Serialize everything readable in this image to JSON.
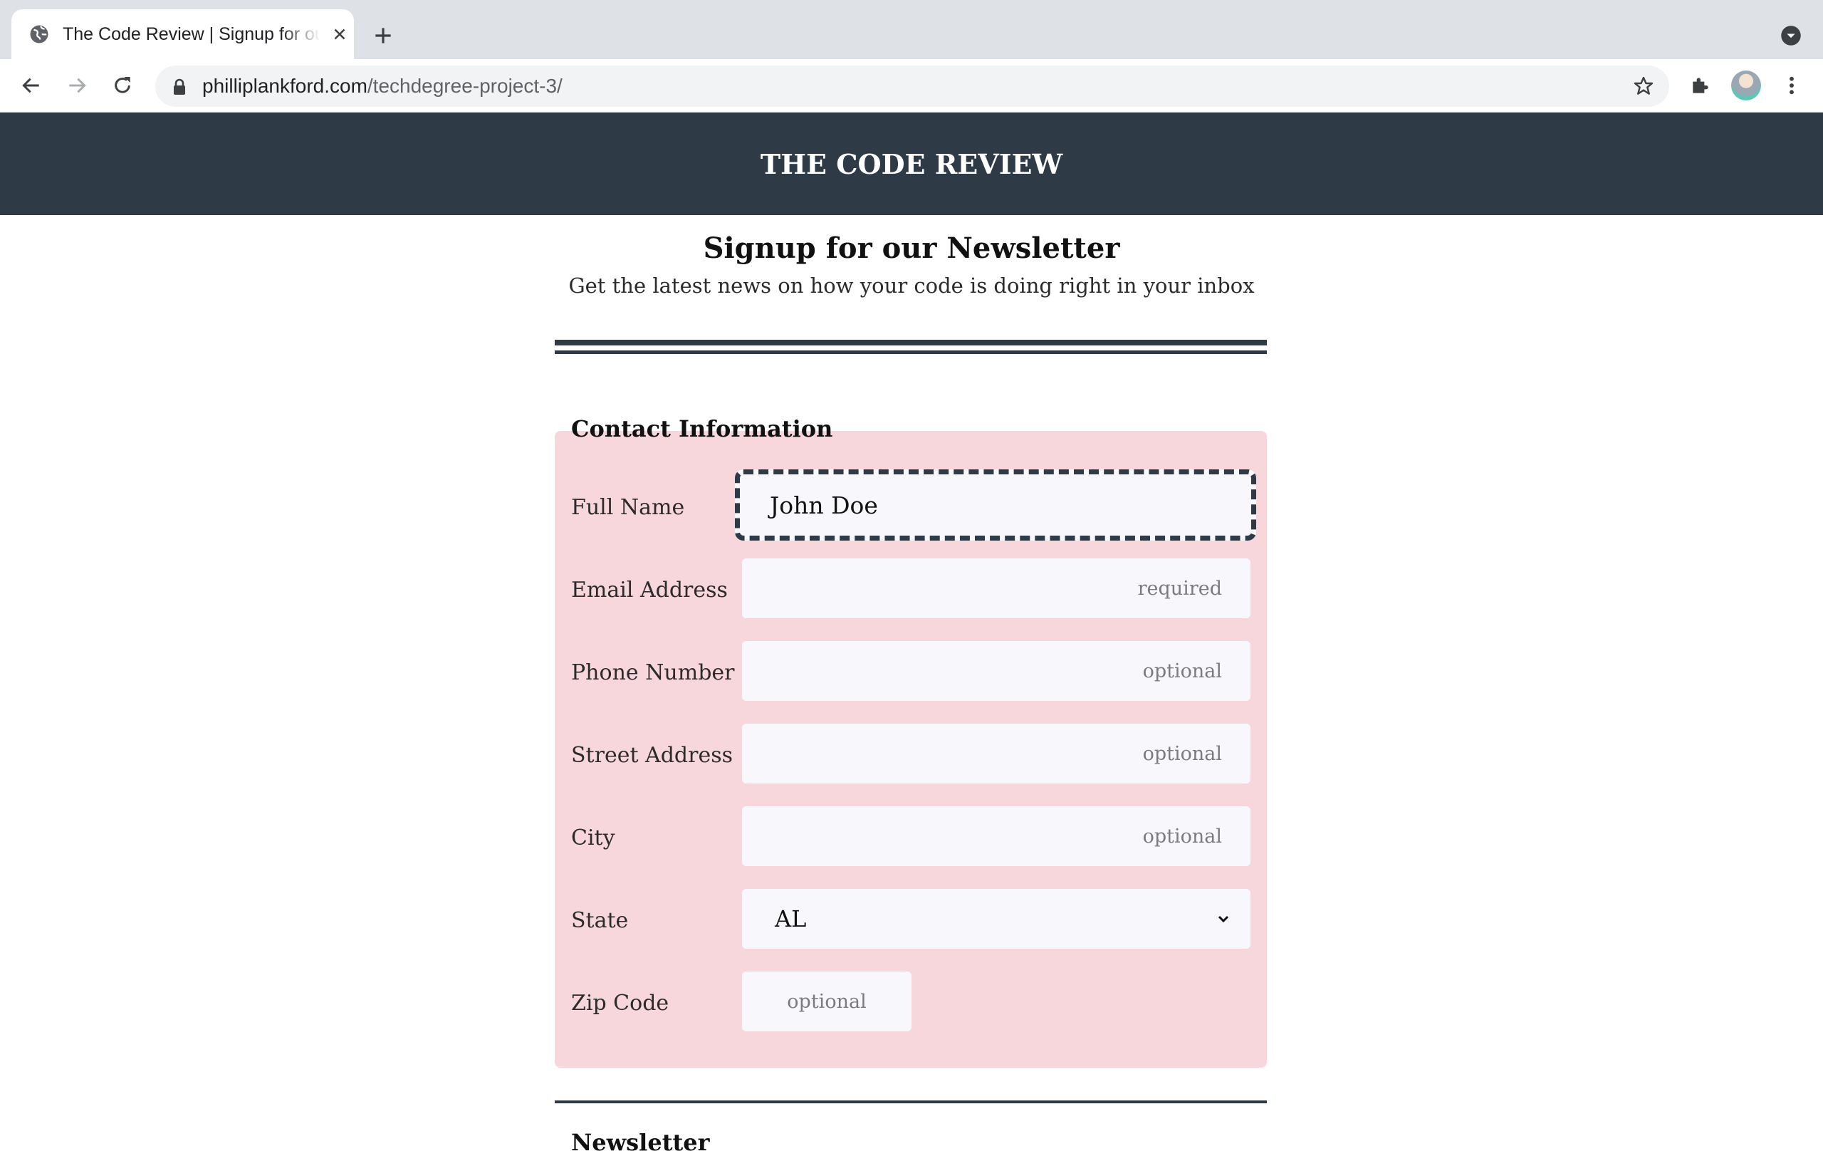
{
  "browser": {
    "tab_title": "The Code Review | Signup for our Newsletter",
    "url_host": "philliplankford.com",
    "url_path": "/techdegree-project-3/"
  },
  "page": {
    "site_title": "THE CODE REVIEW",
    "heading": "Signup for our Newsletter",
    "subheading": "Get the latest news on how your code is doing right in your inbox"
  },
  "form": {
    "legend": "Contact Information",
    "fields": [
      {
        "label": "Full Name",
        "value": "John Doe"
      },
      {
        "label": "Email Address",
        "placeholder": "required"
      },
      {
        "label": "Phone Number",
        "placeholder": "optional"
      },
      {
        "label": "Street Address",
        "placeholder": "optional"
      },
      {
        "label": "City",
        "placeholder": "optional"
      },
      {
        "label": "State",
        "value": "AL"
      },
      {
        "label": "Zip Code",
        "placeholder": "optional"
      }
    ],
    "next_legend": "Newsletter"
  },
  "colors": {
    "header_bg": "#2f3a47",
    "fieldset_bg": "#f8d7dc",
    "input_bg": "#f8f8fc"
  }
}
